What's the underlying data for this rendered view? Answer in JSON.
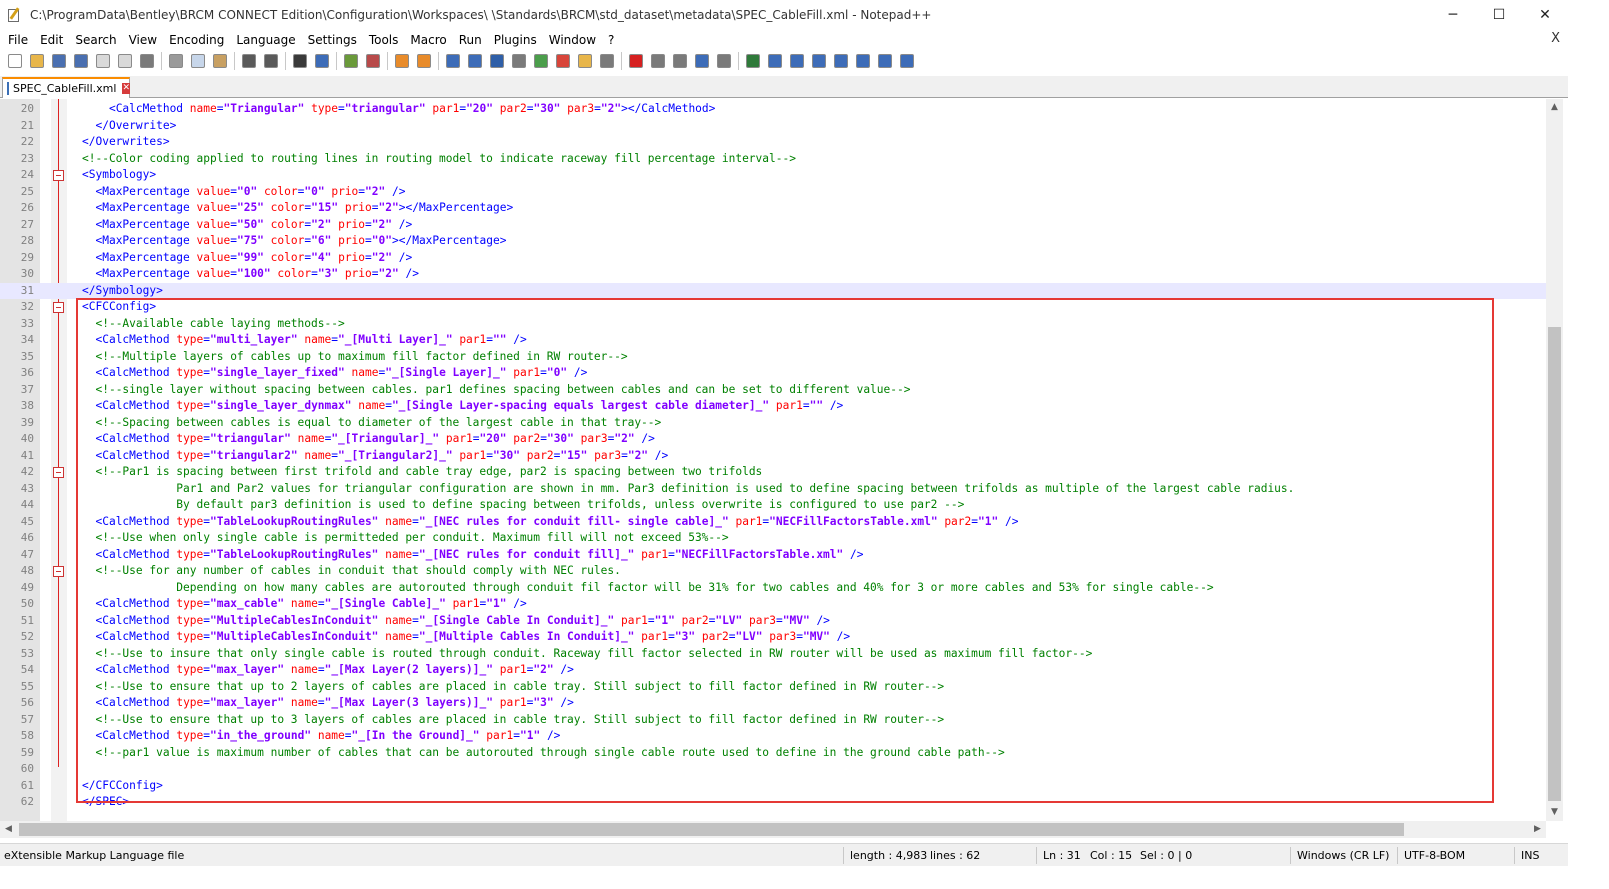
{
  "window": {
    "title": "C:\\ProgramData\\Bentley\\BRCM CONNECT Edition\\Configuration\\Workspaces\\                        \\Standards\\BRCM\\std_dataset\\metadata\\SPEC_CableFill.xml - Notepad++",
    "minimize": "─",
    "maximize": "☐",
    "close": "✕"
  },
  "menu": {
    "items": [
      "File",
      "Edit",
      "Search",
      "View",
      "Encoding",
      "Language",
      "Settings",
      "Tools",
      "Macro",
      "Run",
      "Plugins",
      "Window",
      "?"
    ],
    "close_doc": "X"
  },
  "toolbar": {
    "buttons": [
      {
        "icon": "new-file-icon",
        "color": "#ffffff"
      },
      {
        "icon": "open-file-icon",
        "color": "#e8b64a"
      },
      {
        "icon": "save-icon",
        "color": "#4a6fb0"
      },
      {
        "icon": "save-all-icon",
        "color": "#4a6fb0"
      },
      {
        "icon": "close-icon",
        "color": "#d9d9d9"
      },
      {
        "icon": "close-all-icon",
        "color": "#d9d9d9"
      },
      {
        "icon": "print-icon",
        "color": "#7a7a7a"
      },
      {
        "sep": true
      },
      {
        "icon": "cut-icon",
        "color": "#9a9a9a"
      },
      {
        "icon": "copy-icon",
        "color": "#c7d6ea"
      },
      {
        "icon": "paste-icon",
        "color": "#c8a062"
      },
      {
        "sep": true
      },
      {
        "icon": "undo-icon",
        "color": "#5a5a5a"
      },
      {
        "icon": "redo-icon",
        "color": "#5a5a5a"
      },
      {
        "sep": true
      },
      {
        "icon": "find-icon",
        "color": "#3a3a3a"
      },
      {
        "icon": "replace-icon",
        "color": "#3d6cb8"
      },
      {
        "sep": true
      },
      {
        "icon": "zoom-in-icon",
        "color": "#6a9a3a"
      },
      {
        "icon": "zoom-out-icon",
        "color": "#b84a4a"
      },
      {
        "sep": true
      },
      {
        "icon": "sync-vertical-icon",
        "color": "#e88b2a"
      },
      {
        "icon": "sync-horizontal-icon",
        "color": "#e88b2a"
      },
      {
        "sep": true
      },
      {
        "icon": "word-wrap-icon",
        "color": "#3d6cb8"
      },
      {
        "icon": "show-all-chars-icon",
        "color": "#3d6cb8"
      },
      {
        "icon": "indent-guide-icon",
        "color": "#2f5fa8"
      },
      {
        "icon": "user-lang-icon",
        "color": "#7a7a7a"
      },
      {
        "icon": "doc-map-icon",
        "color": "#4b9e4b"
      },
      {
        "icon": "function-list-icon",
        "color": "#d8453a"
      },
      {
        "icon": "folder-workspace-icon",
        "color": "#e8b64a"
      },
      {
        "icon": "monitoring-icon",
        "color": "#7a7a7a"
      },
      {
        "sep": true
      },
      {
        "icon": "record-macro-icon",
        "color": "#d62020"
      },
      {
        "icon": "stop-macro-icon",
        "color": "#7a7a7a"
      },
      {
        "icon": "play-macro-icon",
        "color": "#7a7a7a"
      },
      {
        "icon": "run-macro-multiple-icon",
        "color": "#3d6cb8"
      },
      {
        "icon": "save-macro-icon",
        "color": "#7a7a7a"
      },
      {
        "sep": true
      },
      {
        "icon": "plugin-a-icon",
        "color": "#2f7a3a"
      },
      {
        "icon": "plugin-b-icon",
        "color": "#3d6cb8"
      },
      {
        "icon": "plugin-c-icon",
        "color": "#3d6cb8"
      },
      {
        "icon": "plugin-d-icon",
        "color": "#3d6cb8"
      },
      {
        "icon": "arrow-up-icon",
        "color": "#3d6cb8"
      },
      {
        "icon": "arrow-down-icon",
        "color": "#3d6cb8"
      },
      {
        "icon": "plugin-e-icon",
        "color": "#3d6cb8"
      },
      {
        "icon": "plugin-f-icon",
        "color": "#3d6cb8"
      }
    ]
  },
  "tab": {
    "label": "SPEC_CableFill.xml",
    "close": "✕"
  },
  "editor": {
    "current_line": 31,
    "lines": [
      {
        "n": 20,
        "html": "    <span class=\"t-tag\">&lt;CalcMethod</span> <span class=\"t-attr\">name</span><span class=\"t-tag\">=</span><span class=\"t-val\">\"Triangular\"</span> <span class=\"t-attr\">type</span><span class=\"t-tag\">=</span><span class=\"t-val\">\"triangular\"</span> <span class=\"t-attr\">par1</span><span class=\"t-tag\">=</span><span class=\"t-val\">\"20\"</span> <span class=\"t-attr\">par2</span><span class=\"t-tag\">=</span><span class=\"t-val\">\"30\"</span> <span class=\"t-attr\">par3</span><span class=\"t-tag\">=</span><span class=\"t-val\">\"2\"</span><span class=\"t-tag\">&gt;&lt;/CalcMethod&gt;</span>"
      },
      {
        "n": 21,
        "html": "  <span class=\"t-tag\">&lt;/Overwrite&gt;</span>"
      },
      {
        "n": 22,
        "html": "<span class=\"t-tag\">&lt;/Overwrites&gt;</span>"
      },
      {
        "n": 23,
        "html": "<span class=\"t-cmt\">&lt;!--Color coding applied to routing lines in routing model to indicate raceway fill percentage interval--&gt;</span>"
      },
      {
        "n": 24,
        "fold": true,
        "html": "<span class=\"t-tag\">&lt;Symbology&gt;</span>"
      },
      {
        "n": 25,
        "html": "  <span class=\"t-tag\">&lt;MaxPercentage</span> <span class=\"t-attr\">value</span><span class=\"t-tag\">=</span><span class=\"t-val\">\"0\"</span> <span class=\"t-attr\">color</span><span class=\"t-tag\">=</span><span class=\"t-val\">\"0\"</span> <span class=\"t-attr\">prio</span><span class=\"t-tag\">=</span><span class=\"t-val\">\"2\"</span> <span class=\"t-tag\">/&gt;</span>"
      },
      {
        "n": 26,
        "html": "  <span class=\"t-tag\">&lt;MaxPercentage</span> <span class=\"t-attr\">value</span><span class=\"t-tag\">=</span><span class=\"t-val\">\"25\"</span> <span class=\"t-attr\">color</span><span class=\"t-tag\">=</span><span class=\"t-val\">\"15\"</span> <span class=\"t-attr\">prio</span><span class=\"t-tag\">=</span><span class=\"t-val\">\"2\"</span><span class=\"t-tag\">&gt;&lt;/MaxPercentage&gt;</span>"
      },
      {
        "n": 27,
        "html": "  <span class=\"t-tag\">&lt;MaxPercentage</span> <span class=\"t-attr\">value</span><span class=\"t-tag\">=</span><span class=\"t-val\">\"50\"</span> <span class=\"t-attr\">color</span><span class=\"t-tag\">=</span><span class=\"t-val\">\"2\"</span> <span class=\"t-attr\">prio</span><span class=\"t-tag\">=</span><span class=\"t-val\">\"2\"</span> <span class=\"t-tag\">/&gt;</span>"
      },
      {
        "n": 28,
        "html": "  <span class=\"t-tag\">&lt;MaxPercentage</span> <span class=\"t-attr\">value</span><span class=\"t-tag\">=</span><span class=\"t-val\">\"75\"</span> <span class=\"t-attr\">color</span><span class=\"t-tag\">=</span><span class=\"t-val\">\"6\"</span> <span class=\"t-attr\">prio</span><span class=\"t-tag\">=</span><span class=\"t-val\">\"0\"</span><span class=\"t-tag\">&gt;&lt;/MaxPercentage&gt;</span>"
      },
      {
        "n": 29,
        "html": "  <span class=\"t-tag\">&lt;MaxPercentage</span> <span class=\"t-attr\">value</span><span class=\"t-tag\">=</span><span class=\"t-val\">\"99\"</span> <span class=\"t-attr\">color</span><span class=\"t-tag\">=</span><span class=\"t-val\">\"4\"</span> <span class=\"t-attr\">prio</span><span class=\"t-tag\">=</span><span class=\"t-val\">\"2\"</span> <span class=\"t-tag\">/&gt;</span>"
      },
      {
        "n": 30,
        "html": "  <span class=\"t-tag\">&lt;MaxPercentage</span> <span class=\"t-attr\">value</span><span class=\"t-tag\">=</span><span class=\"t-val\">\"100\"</span> <span class=\"t-attr\">color</span><span class=\"t-tag\">=</span><span class=\"t-val\">\"3\"</span> <span class=\"t-attr\">prio</span><span class=\"t-tag\">=</span><span class=\"t-val\">\"2\"</span> <span class=\"t-tag\">/&gt;</span>"
      },
      {
        "n": 31,
        "html": "<span class=\"t-tag\">&lt;/Symbology&gt;</span>"
      },
      {
        "n": 32,
        "fold": true,
        "html": "<span class=\"t-tag\">&lt;CFCConfig&gt;</span>"
      },
      {
        "n": 33,
        "html": "  <span class=\"t-cmt\">&lt;!--Available cable laying methods--&gt;</span>"
      },
      {
        "n": 34,
        "html": "  <span class=\"t-tag\">&lt;CalcMethod</span> <span class=\"t-attr\">type</span><span class=\"t-tag\">=</span><span class=\"t-val\">\"multi_layer\"</span> <span class=\"t-attr\">name</span><span class=\"t-tag\">=</span><span class=\"t-val\">\"_[Multi Layer]_\"</span> <span class=\"t-attr\">par1</span><span class=\"t-tag\">=</span><span class=\"t-val\">\"\"</span> <span class=\"t-tag\">/&gt;</span>"
      },
      {
        "n": 35,
        "html": "  <span class=\"t-cmt\">&lt;!--Multiple layers of cables up to maximum fill factor defined in RW router--&gt;</span>"
      },
      {
        "n": 36,
        "html": "  <span class=\"t-tag\">&lt;CalcMethod</span> <span class=\"t-attr\">type</span><span class=\"t-tag\">=</span><span class=\"t-val\">\"single_layer_fixed\"</span> <span class=\"t-attr\">name</span><span class=\"t-tag\">=</span><span class=\"t-val\">\"_[Single Layer]_\"</span> <span class=\"t-attr\">par1</span><span class=\"t-tag\">=</span><span class=\"t-val\">\"0\"</span> <span class=\"t-tag\">/&gt;</span>"
      },
      {
        "n": 37,
        "html": "  <span class=\"t-cmt\">&lt;!--single layer without spacing between cables. par1 defines spacing between cables and can be set to different value--&gt;</span>"
      },
      {
        "n": 38,
        "html": "  <span class=\"t-tag\">&lt;CalcMethod</span> <span class=\"t-attr\">type</span><span class=\"t-tag\">=</span><span class=\"t-val\">\"single_layer_dynmax\"</span> <span class=\"t-attr\">name</span><span class=\"t-tag\">=</span><span class=\"t-val\">\"_[Single Layer-spacing equals largest cable diameter]_\"</span> <span class=\"t-attr\">par1</span><span class=\"t-tag\">=</span><span class=\"t-val\">\"\"</span> <span class=\"t-tag\">/&gt;</span>"
      },
      {
        "n": 39,
        "html": "  <span class=\"t-cmt\">&lt;!--Spacing between cables is equal to diameter of the largest cable in that tray--&gt;</span>"
      },
      {
        "n": 40,
        "html": "  <span class=\"t-tag\">&lt;CalcMethod</span> <span class=\"t-attr\">type</span><span class=\"t-tag\">=</span><span class=\"t-val\">\"triangular\"</span> <span class=\"t-attr\">name</span><span class=\"t-tag\">=</span><span class=\"t-val\">\"_[Triangular]_\"</span> <span class=\"t-attr\">par1</span><span class=\"t-tag\">=</span><span class=\"t-val\">\"20\"</span> <span class=\"t-attr\">par2</span><span class=\"t-tag\">=</span><span class=\"t-val\">\"30\"</span> <span class=\"t-attr\">par3</span><span class=\"t-tag\">=</span><span class=\"t-val\">\"2\"</span> <span class=\"t-tag\">/&gt;</span>"
      },
      {
        "n": 41,
        "html": "  <span class=\"t-tag\">&lt;CalcMethod</span> <span class=\"t-attr\">type</span><span class=\"t-tag\">=</span><span class=\"t-val\">\"triangular2\"</span> <span class=\"t-attr\">name</span><span class=\"t-tag\">=</span><span class=\"t-val\">\"_[Triangular2]_\"</span> <span class=\"t-attr\">par1</span><span class=\"t-tag\">=</span><span class=\"t-val\">\"30\"</span> <span class=\"t-attr\">par2</span><span class=\"t-tag\">=</span><span class=\"t-val\">\"15\"</span> <span class=\"t-attr\">par3</span><span class=\"t-tag\">=</span><span class=\"t-val\">\"2\"</span> <span class=\"t-tag\">/&gt;</span>"
      },
      {
        "n": 42,
        "fold": true,
        "html": "  <span class=\"t-cmt\">&lt;!--Par1 is spacing between first trifold and cable tray edge, par2 is spacing between two trifolds</span>"
      },
      {
        "n": 43,
        "html": "<span class=\"t-cmt\">              Par1 and Par2 values for triangular configuration are shown in mm. Par3 definition is used to define spacing between trifolds as multiple of the largest cable radius.</span>"
      },
      {
        "n": 44,
        "html": "<span class=\"t-cmt\">              By default par3 definition is used to define spacing between trifolds, unless overwrite is configured to use par2 --&gt;</span>"
      },
      {
        "n": 45,
        "html": "  <span class=\"t-tag\">&lt;CalcMethod</span> <span class=\"t-attr\">type</span><span class=\"t-tag\">=</span><span class=\"t-val\">\"TableLookupRoutingRules\"</span> <span class=\"t-attr\">name</span><span class=\"t-tag\">=</span><span class=\"t-val\">\"_[NEC rules for conduit fill- single cable]_\"</span> <span class=\"t-attr\">par1</span><span class=\"t-tag\">=</span><span class=\"t-val\">\"NECFillFactorsTable.xml\"</span> <span class=\"t-attr\">par2</span><span class=\"t-tag\">=</span><span class=\"t-val\">\"1\"</span> <span class=\"t-tag\">/&gt;</span>"
      },
      {
        "n": 46,
        "html": "  <span class=\"t-cmt\">&lt;!--Use when only single cable is permitteded per conduit. Maximum fill will not exceed 53%--&gt;</span>"
      },
      {
        "n": 47,
        "html": "  <span class=\"t-tag\">&lt;CalcMethod</span> <span class=\"t-attr\">type</span><span class=\"t-tag\">=</span><span class=\"t-val\">\"TableLookupRoutingRules\"</span> <span class=\"t-attr\">name</span><span class=\"t-tag\">=</span><span class=\"t-val\">\"_[NEC rules for conduit fill]_\"</span> <span class=\"t-attr\">par1</span><span class=\"t-tag\">=</span><span class=\"t-val\">\"NECFillFactorsTable.xml\"</span> <span class=\"t-tag\">/&gt;</span>"
      },
      {
        "n": 48,
        "fold": true,
        "html": "  <span class=\"t-cmt\">&lt;!--Use for any number of cables in conduit that should comply with NEC rules.</span>"
      },
      {
        "n": 49,
        "html": "<span class=\"t-cmt\">              Depending on how many cables are autorouted through conduit fil factor will be 31% for two cables and 40% for 3 or more cables and 53% for single cable--&gt;</span>"
      },
      {
        "n": 50,
        "html": "  <span class=\"t-tag\">&lt;CalcMethod</span> <span class=\"t-attr\">type</span><span class=\"t-tag\">=</span><span class=\"t-val\">\"max_cable\"</span> <span class=\"t-attr\">name</span><span class=\"t-tag\">=</span><span class=\"t-val\">\"_[Single Cable]_\"</span> <span class=\"t-attr\">par1</span><span class=\"t-tag\">=</span><span class=\"t-val\">\"1\"</span> <span class=\"t-tag\">/&gt;</span>"
      },
      {
        "n": 51,
        "html": "  <span class=\"t-tag\">&lt;CalcMethod</span> <span class=\"t-attr\">type</span><span class=\"t-tag\">=</span><span class=\"t-val\">\"MultipleCablesInConduit\"</span> <span class=\"t-attr\">name</span><span class=\"t-tag\">=</span><span class=\"t-val\">\"_[Single Cable In Conduit]_\"</span> <span class=\"t-attr\">par1</span><span class=\"t-tag\">=</span><span class=\"t-val\">\"1\"</span> <span class=\"t-attr\">par2</span><span class=\"t-tag\">=</span><span class=\"t-val\">\"LV\"</span> <span class=\"t-attr\">par3</span><span class=\"t-tag\">=</span><span class=\"t-val\">\"MV\"</span> <span class=\"t-tag\">/&gt;</span>"
      },
      {
        "n": 52,
        "html": "  <span class=\"t-tag\">&lt;CalcMethod</span> <span class=\"t-attr\">type</span><span class=\"t-tag\">=</span><span class=\"t-val\">\"MultipleCablesInConduit\"</span> <span class=\"t-attr\">name</span><span class=\"t-tag\">=</span><span class=\"t-val\">\"_[Multiple Cables In Conduit]_\"</span> <span class=\"t-attr\">par1</span><span class=\"t-tag\">=</span><span class=\"t-val\">\"3\"</span> <span class=\"t-attr\">par2</span><span class=\"t-tag\">=</span><span class=\"t-val\">\"LV\"</span> <span class=\"t-attr\">par3</span><span class=\"t-tag\">=</span><span class=\"t-val\">\"MV\"</span> <span class=\"t-tag\">/&gt;</span>"
      },
      {
        "n": 53,
        "html": "  <span class=\"t-cmt\">&lt;!--Use to insure that only single cable is routed through conduit. Raceway fill factor selected in RW router will be used as maximum fill factor--&gt;</span>"
      },
      {
        "n": 54,
        "html": "  <span class=\"t-tag\">&lt;CalcMethod</span> <span class=\"t-attr\">type</span><span class=\"t-tag\">=</span><span class=\"t-val\">\"max_layer\"</span> <span class=\"t-attr\">name</span><span class=\"t-tag\">=</span><span class=\"t-val\">\"_[Max Layer(2 layers)]_\"</span> <span class=\"t-attr\">par1</span><span class=\"t-tag\">=</span><span class=\"t-val\">\"2\"</span> <span class=\"t-tag\">/&gt;</span>"
      },
      {
        "n": 55,
        "html": "  <span class=\"t-cmt\">&lt;!--Use to ensure that up to 2 layers of cables are placed in cable tray. Still subject to fill factor defined in RW router--&gt;</span>"
      },
      {
        "n": 56,
        "html": "  <span class=\"t-tag\">&lt;CalcMethod</span> <span class=\"t-attr\">type</span><span class=\"t-tag\">=</span><span class=\"t-val\">\"max_layer\"</span> <span class=\"t-attr\">name</span><span class=\"t-tag\">=</span><span class=\"t-val\">\"_[Max Layer(3 layers)]_\"</span> <span class=\"t-attr\">par1</span><span class=\"t-tag\">=</span><span class=\"t-val\">\"3\"</span> <span class=\"t-tag\">/&gt;</span>"
      },
      {
        "n": 57,
        "html": "  <span class=\"t-cmt\">&lt;!--Use to ensure that up to 3 layers of cables are placed in cable tray. Still subject to fill factor defined in RW router--&gt;</span>"
      },
      {
        "n": 58,
        "html": "  <span class=\"t-tag\">&lt;CalcMethod</span> <span class=\"t-attr\">type</span><span class=\"t-tag\">=</span><span class=\"t-val\">\"in_the_ground\"</span> <span class=\"t-attr\">name</span><span class=\"t-tag\">=</span><span class=\"t-val\">\"_[In the Ground]_\"</span> <span class=\"t-attr\">par1</span><span class=\"t-tag\">=</span><span class=\"t-val\">\"1\"</span> <span class=\"t-tag\">/&gt;</span>"
      },
      {
        "n": 59,
        "html": "  <span class=\"t-cmt\">&lt;!--par1 value is maximum number of cables that can be autorouted through single cable route used to define in the ground cable path--&gt;</span>"
      },
      {
        "n": 60,
        "html": ""
      },
      {
        "n": 61,
        "html": "<span class=\"t-tag\">&lt;/CFCConfig&gt;</span>"
      },
      {
        "n": 62,
        "html": "<span class=\"t-tag\">&lt;/SPEC&gt;</span>"
      }
    ]
  },
  "status": {
    "file_type": "eXtensible Markup Language file",
    "length": "length : 4,983",
    "lines": "lines : 62",
    "ln": "Ln : 31",
    "col": "Col : 15",
    "sel": "Sel : 0 | 0",
    "eol": "Windows (CR LF)",
    "encoding": "UTF-8-BOM",
    "mode": "INS"
  }
}
